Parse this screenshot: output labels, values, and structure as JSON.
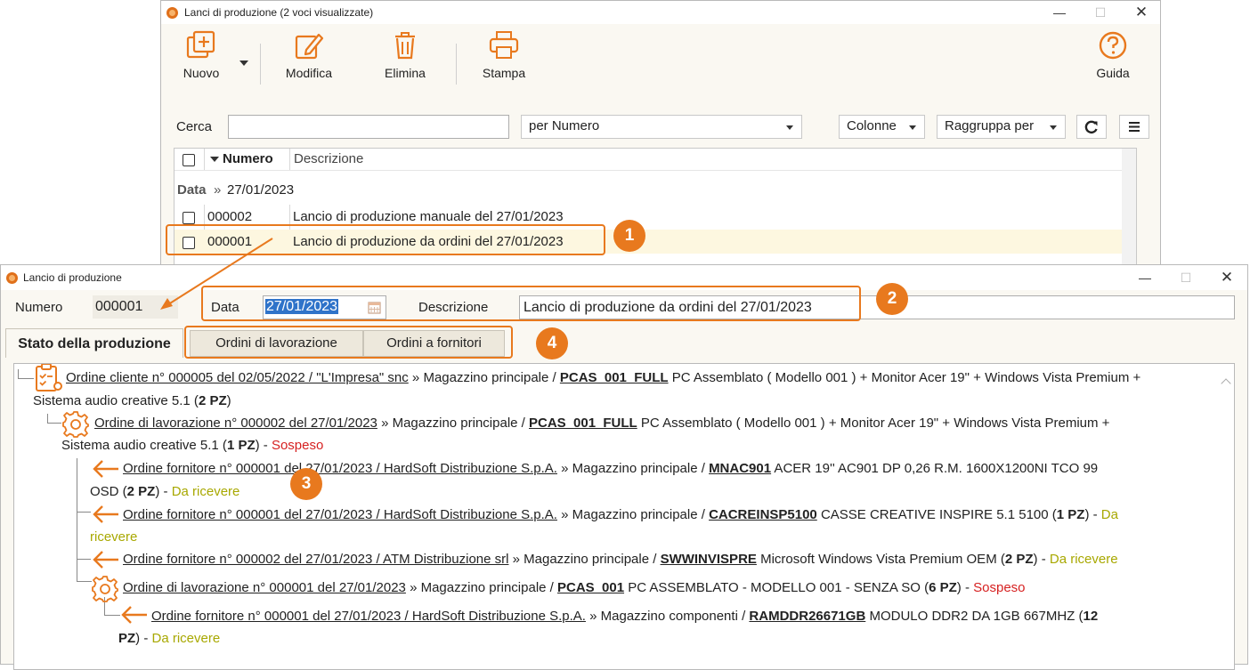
{
  "list_window": {
    "title": "Lanci di produzione (2 voci visualizzate)",
    "toolbar": {
      "new_label": "Nuovo",
      "edit_label": "Modifica",
      "delete_label": "Elimina",
      "print_label": "Stampa",
      "help_label": "Guida"
    },
    "search": {
      "label": "Cerca",
      "value": "",
      "by": "per Numero",
      "columns_label": "Colonne",
      "group_label": "Raggruppa per"
    },
    "grid": {
      "columns": [
        "Numero",
        "Descrizione"
      ],
      "group_key": "Data",
      "group_sep": "»",
      "group_value": "27/01/2023",
      "rows": [
        {
          "numero": "000002",
          "descrizione": "Lancio di produzione manuale del 27/01/2023"
        },
        {
          "numero": "000001",
          "descrizione": "Lancio di produzione da ordini del 27/01/2023"
        }
      ]
    }
  },
  "detail_window": {
    "title": "Lancio di produzione",
    "numero_label": "Numero",
    "numero_value": "000001",
    "data_label": "Data",
    "data_value": "27/01/2023",
    "descrizione_label": "Descrizione",
    "descrizione_value": "Lancio di produzione da ordini del 27/01/2023",
    "tabs": [
      "Stato della produzione",
      "Ordini di lavorazione",
      "Ordini a fornitori"
    ],
    "tree": {
      "n1": {
        "link": "Ordine cliente n° 000005 del 02/05/2022 / \"L'Impresa\" snc",
        "mid": " » Magazzino principale / ",
        "code": "PCAS_001_FULL",
        "desc": " PC Assemblato ( Modello 001 ) + Monitor Acer 19\" + Windows Vista Premium +",
        "cont": "Sistema audio creative 5.1 (",
        "qty": "2 PZ",
        "close": ")"
      },
      "n2": {
        "link": "Ordine di lavorazione n° 000002 del 27/01/2023",
        "mid": " » Magazzino principale / ",
        "code": "PCAS_001_FULL",
        "desc": " PC Assemblato ( Modello 001 ) + Monitor Acer 19\" + Windows Vista Premium +",
        "cont": "Sistema audio creative 5.1 (",
        "qty": "1 PZ",
        "close": ") - ",
        "status": "Sospeso"
      },
      "n3": {
        "link": "Ordine fornitore n° 000001 del 27/01/2023 / HardSoft Distribuzione S.p.A.",
        "mid": " » Magazzino principale / ",
        "code": "MNAC901",
        "desc": " ACER 19'' AC901 DP 0,26 R.M. 1600X1200NI TCO 99",
        "cont": "OSD (",
        "qty": "2 PZ",
        "close": ") - ",
        "status": "Da ricevere"
      },
      "n4": {
        "link": "Ordine fornitore n° 000001 del 27/01/2023 / HardSoft Distribuzione S.p.A.",
        "mid": " » Magazzino principale / ",
        "code": "CACREINSP5100",
        "desc": " CASSE CREATIVE INSPIRE 5.1 5100 (",
        "qty": "1 PZ",
        "close": ") - ",
        "status_a": "Da",
        "status_b": "ricevere"
      },
      "n5": {
        "link": "Ordine fornitore n° 000002 del 27/01/2023 / ATM Distribuzione srl",
        "mid": " » Magazzino principale / ",
        "code": "SWWINVISPRE",
        "desc": " Microsoft Windows Vista Premium OEM (",
        "qty": "2 PZ",
        "close": ") - ",
        "status": "Da ricevere"
      },
      "n6": {
        "link": "Ordine di lavorazione n° 000001 del 27/01/2023",
        "mid": " » Magazzino principale / ",
        "code": "PCAS_001",
        "desc": " PC ASSEMBLATO - MODELLO 001 - SENZA SO (",
        "qty": "6 PZ",
        "close": ") - ",
        "status": "Sospeso"
      },
      "n7": {
        "link": "Ordine fornitore n° 000001 del 27/01/2023 / HardSoft Distribuzione S.p.A.",
        "mid": " » Magazzino componenti / ",
        "code": "RAMDDR26671GB",
        "desc": " MODULO DDR2 DA 1GB 667MHZ (",
        "qty_a": "12",
        "qty_b": "PZ",
        "close": ") - ",
        "status": "Da ricevere"
      }
    }
  },
  "badges": [
    "1",
    "2",
    "3",
    "4"
  ],
  "colors": {
    "accent": "#e8791e",
    "sospeso": "#d62121",
    "da_ricevere": "#a8a800"
  }
}
